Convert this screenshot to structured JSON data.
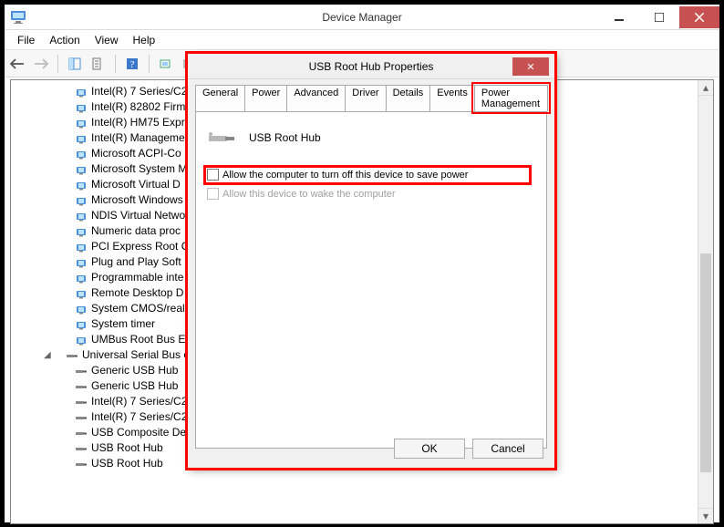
{
  "app": {
    "title": "Device Manager"
  },
  "menu": {
    "file": "File",
    "action": "Action",
    "view": "View",
    "help": "Help"
  },
  "tree": {
    "items": [
      {
        "label": "Intel(R) 7 Series/C2",
        "type": "chip"
      },
      {
        "label": "Intel(R) 82802 Firm",
        "type": "chip"
      },
      {
        "label": "Intel(R) HM75 Expr",
        "type": "chip"
      },
      {
        "label": "Intel(R) Managemen",
        "type": "chip"
      },
      {
        "label": "Microsoft ACPI-Co",
        "type": "chip"
      },
      {
        "label": "Microsoft System M",
        "type": "chip"
      },
      {
        "label": "Microsoft Virtual D",
        "type": "chip"
      },
      {
        "label": "Microsoft Windows",
        "type": "chip"
      },
      {
        "label": "NDIS Virtual Netwo",
        "type": "chip"
      },
      {
        "label": "Numeric data proc",
        "type": "chip"
      },
      {
        "label": "PCI Express Root C",
        "type": "chip"
      },
      {
        "label": "Plug and Play Soft",
        "type": "chip"
      },
      {
        "label": "Programmable inte",
        "type": "chip"
      },
      {
        "label": "Remote Desktop D",
        "type": "chip"
      },
      {
        "label": "System CMOS/real",
        "type": "chip"
      },
      {
        "label": "System timer",
        "type": "chip"
      },
      {
        "label": "UMBus Root Bus E",
        "type": "chip"
      }
    ],
    "usb_header": "Universal Serial Bus co",
    "usb_children": [
      {
        "label": "Generic USB Hub"
      },
      {
        "label": "Generic USB Hub"
      },
      {
        "label": "Intel(R) 7 Series/C2"
      },
      {
        "label": "Intel(R) 7 Series/C2"
      },
      {
        "label": "USB Composite De"
      },
      {
        "label": "USB Root Hub"
      },
      {
        "label": "USB Root Hub"
      }
    ]
  },
  "dialog": {
    "title": "USB Root Hub Properties",
    "device_name": "USB Root Hub",
    "tabs": {
      "general": "General",
      "power": "Power",
      "advanced": "Advanced",
      "driver": "Driver",
      "details": "Details",
      "events": "Events",
      "power_management": "Power Management"
    },
    "checkbox1_label": "Allow the computer to turn off this device to save power",
    "checkbox2_label": "Allow this device to wake the computer",
    "ok": "OK",
    "cancel": "Cancel"
  }
}
